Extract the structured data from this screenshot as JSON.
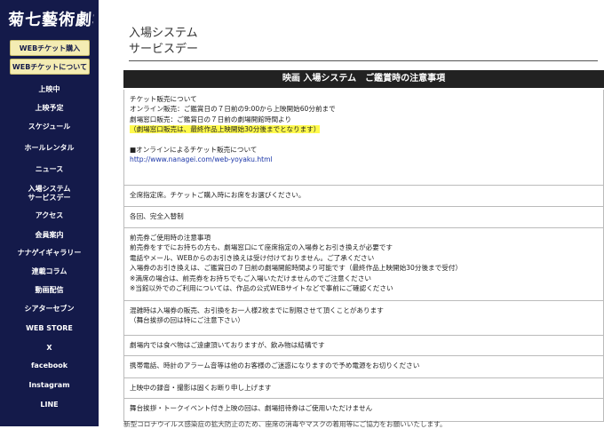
{
  "sidebar": {
    "logo": "菊七藝術劇場",
    "ticket_buttons": [
      "WEBチケット購入",
      "WEBチケットについて"
    ],
    "nav": [
      {
        "lines": [
          "上映中"
        ]
      },
      {
        "lines": [
          "上映予定"
        ]
      },
      {
        "lines": [
          "スケジュール"
        ]
      },
      {
        "lines": [
          "ホールレンタル"
        ]
      },
      {
        "lines": [
          "ニュース"
        ]
      },
      {
        "lines": [
          "入場システム",
          "サービスデー"
        ]
      },
      {
        "lines": [
          "アクセス"
        ]
      },
      {
        "lines": [
          "会員案内"
        ]
      },
      {
        "lines": [
          "ナナゲイギャラリー"
        ]
      },
      {
        "lines": [
          "連載コラム"
        ]
      },
      {
        "lines": [
          "動画配信"
        ]
      },
      {
        "lines": [
          "シアターセブン"
        ]
      },
      {
        "lines": [
          "WEB STORE"
        ]
      },
      {
        "lines": [
          "X"
        ]
      },
      {
        "lines": [
          "facebook"
        ]
      },
      {
        "lines": [
          "Instagram"
        ]
      },
      {
        "lines": [
          "LINE"
        ]
      }
    ]
  },
  "main": {
    "title_lines": [
      "入場システム",
      "サービスデー"
    ],
    "section_header": "映画 入場システム　ご鑑賞時の注意事項",
    "rules": [
      {
        "lines": [
          {
            "text": "チケット販売について"
          },
          {
            "text": "オンライン販売：ご鑑賞日の７日前の9:00から上映開始60分前まで"
          },
          {
            "text": "劇場窓口販売：ご鑑賞日の７日前の劇場開館時間より"
          },
          {
            "text": "（劇場窓口販売は、最終作品上映開始30分後までとなります）",
            "highlight": true
          },
          {
            "text": "",
            "spacer": true
          },
          {
            "text": "■オンラインによるチケット販売について"
          },
          {
            "text": "http://www.nanagei.com/web-yoyaku.html",
            "link": true
          }
        ]
      },
      {
        "lines": [
          {
            "text": "全席指定席。チケットご購入時にお席をお選びください。"
          }
        ]
      },
      {
        "lines": [
          {
            "text": "各回、完全入替制"
          }
        ]
      },
      {
        "lines": [
          {
            "text": "前売券ご使用時の注意事項"
          },
          {
            "text": "前売券をすでにお持ちの方も、劇場窓口にて座席指定の入場券とお引き換えが必要です"
          },
          {
            "text": "電話やメール、WEBからのお引き換えは受け付けておりません。ご了承ください"
          },
          {
            "text": "入場券のお引き換えは、ご鑑賞日の７日前の劇場開館時間より可能です（最終作品上映開始30分後まで受付）"
          },
          {
            "text": "※満席の場合は、前売券をお持ちでもご入場いただけませんのでご注意ください"
          },
          {
            "text": "※当館以外でのご利用については、作品の公式WEBサイトなどで事前にご確認ください"
          }
        ]
      },
      {
        "lines": [
          {
            "text": "混雑時は入場券の販売、お引換をお一人様2枚までに制限させて頂くことがあります"
          },
          {
            "text": "（舞台挨拶の回は特にご注意下さい）"
          }
        ]
      },
      {
        "lines": [
          {
            "text": "劇場内では食べ物はご遠慮頂いておりますが、飲み物は結構です"
          }
        ]
      },
      {
        "lines": [
          {
            "text": "携帯電話、時計のアラーム音等は他のお客様のご迷惑になりますので予め電源をお切りください"
          }
        ]
      },
      {
        "lines": [
          {
            "text": "上映中の録音・撮影は固くお断り申し上げます"
          }
        ]
      },
      {
        "lines": [
          {
            "text": "舞台挨拶・トークイベント付き上映の回は、劇場招待券はご使用いただけません"
          }
        ]
      }
    ],
    "footer_partial": "新型コロナウイルス感染症の拡大防止のため、座席の消毒やマスクの着用等にご協力をお願いいたします。"
  }
}
